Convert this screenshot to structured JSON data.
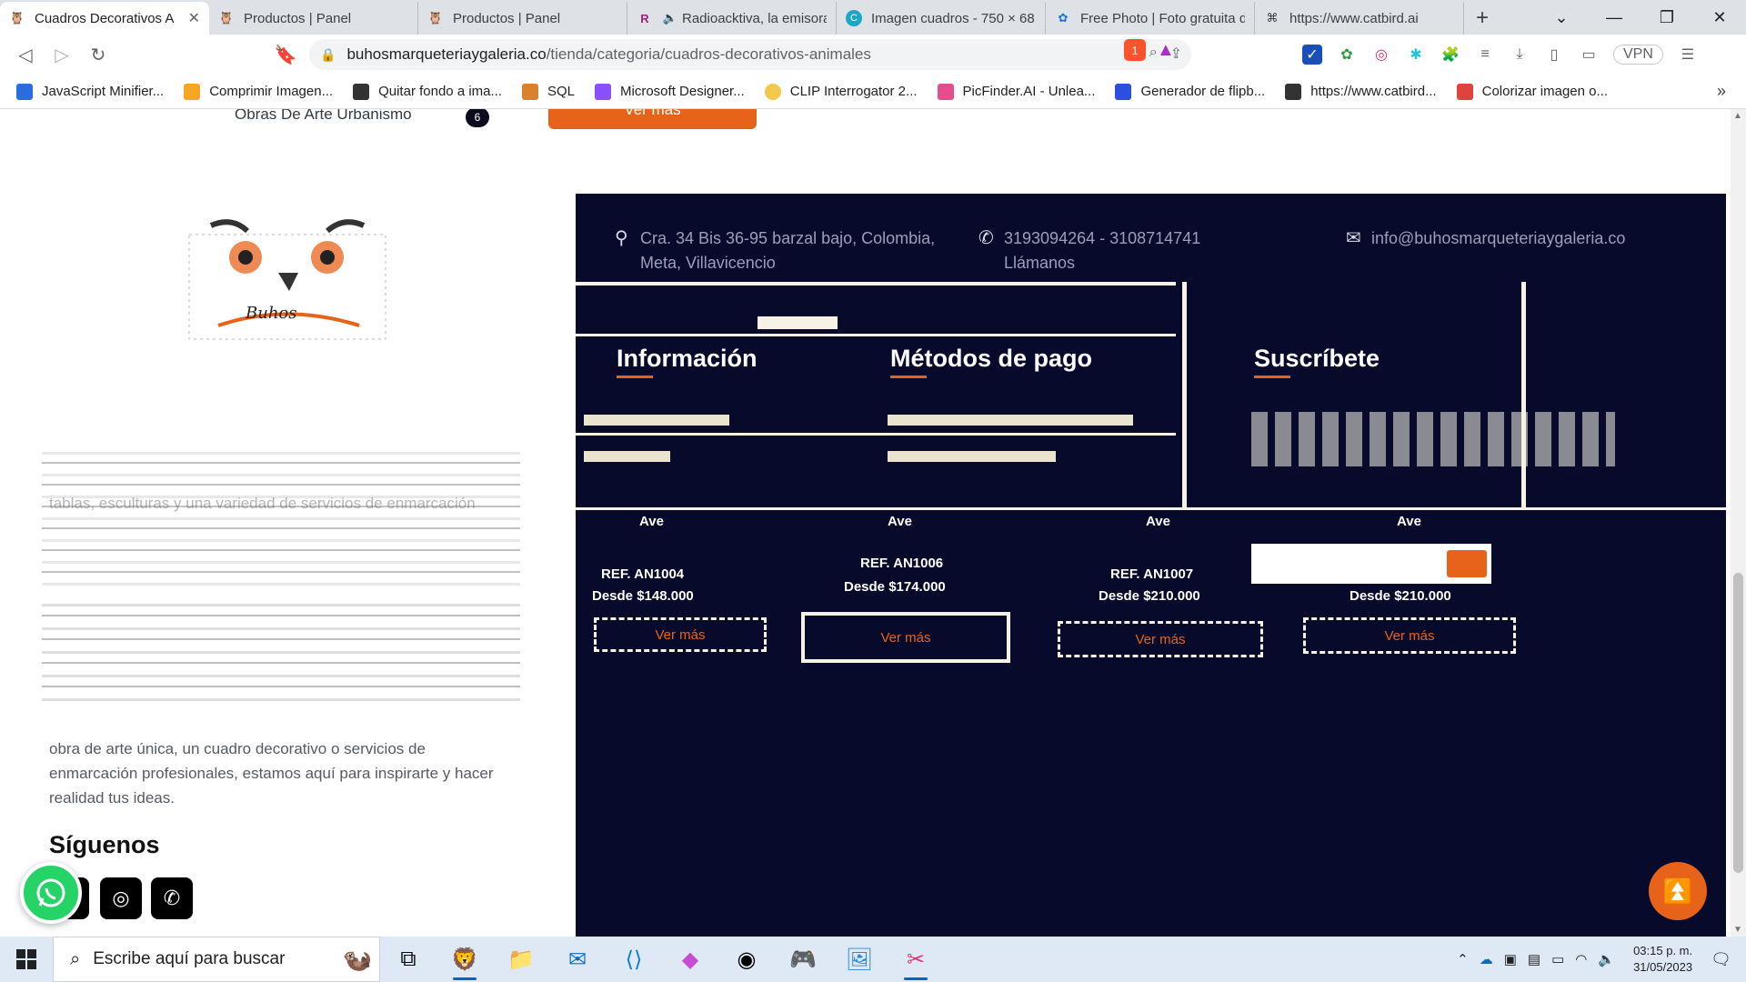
{
  "browser": {
    "tabs": [
      {
        "title": "Cuadros Decorativos A",
        "active": true,
        "icon": "owl-favicon"
      },
      {
        "title": "Productos | Panel",
        "active": false,
        "icon": "owl-favicon"
      },
      {
        "title": "Productos | Panel",
        "active": false,
        "icon": "owl-favicon"
      },
      {
        "title": "Radioacktiva, la emisora",
        "active": false,
        "icon": "radio-favicon"
      },
      {
        "title": "Imagen cuadros - 750 × 68",
        "active": false,
        "icon": "canva-favicon"
      },
      {
        "title": "Free Photo | Foto gratuita d",
        "active": false,
        "icon": "freepik-favicon"
      },
      {
        "title": "https://www.catbird.ai",
        "active": false,
        "icon": "catbird-favicon"
      }
    ],
    "url_domain": "buhosmarqueteriaygaleria.co",
    "url_path": "/tienda/categoria/cuadros-decorativos-animales",
    "vpn_label": "VPN",
    "brave_badge": "1"
  },
  "bookmarks": [
    {
      "label": "JavaScript Minifier...",
      "color": "#2d6cdf"
    },
    {
      "label": "Comprimir Imagen...",
      "color": "#f5a623"
    },
    {
      "label": "Quitar fondo a ima...",
      "color": "#333333"
    },
    {
      "label": "SQL",
      "color": "#d9822b"
    },
    {
      "label": "Microsoft Designer...",
      "color": "#8a4fff"
    },
    {
      "label": "CLIP Interrogator 2...",
      "color": "#f2c94c"
    },
    {
      "label": "PicFinder.AI - Unlea...",
      "color": "#e24f8f"
    },
    {
      "label": "Generador de flipb...",
      "color": "#2d4fdf"
    },
    {
      "label": "https://www.catbird...",
      "color": "#333333"
    },
    {
      "label": "Colorizar imagen o...",
      "color": "#e0433b"
    }
  ],
  "page": {
    "category_item": {
      "label": "Obras De Arte Urbanismo",
      "count": "6"
    },
    "ver_mas_top": "Ver más",
    "contact": {
      "address_line1": "Cra. 34 Bis 36-95 barzal bajo, Colombia,",
      "address_line2": "Meta, Villavicencio",
      "phone_line1": "3193094264 - 3108714741",
      "phone_line2": "Llámanos",
      "email": "info@buhosmarqueteriaygaleria.co"
    },
    "columns": {
      "info": "Información",
      "payment": "Métodos de pago",
      "subscribe": "Suscríbete"
    },
    "products": [
      {
        "name": "Ave",
        "ref": "REF. AN1004",
        "price": "Desde $148.000",
        "button": "Ver más"
      },
      {
        "name": "Ave",
        "ref": "REF. AN1006",
        "price": "Desde $174.000",
        "button": "Ver más"
      },
      {
        "name": "Ave",
        "ref": "REF. AN1007",
        "price": "Desde $210.000",
        "button": "Ver más"
      },
      {
        "name": "Ave",
        "ref": "",
        "price": "Desde $210.000",
        "button": "Ver más"
      }
    ],
    "about_tail": [
      "tablas, esculturas y una variedad de servicios de enmarcación",
      "obra de arte única, un cuadro decorativo o servicios de",
      "enmarcación profesionales, estamos aquí para inspirarte y hacer",
      "realidad tus ideas."
    ],
    "follow_title": "Síguenos"
  },
  "taskbar": {
    "search_placeholder": "Escribe aquí para buscar",
    "time": "03:15 p. m.",
    "date": "31/05/2023"
  },
  "colors": {
    "footer_bg": "#070a2a",
    "accent": "#e8631a",
    "whatsapp": "#25d366"
  }
}
